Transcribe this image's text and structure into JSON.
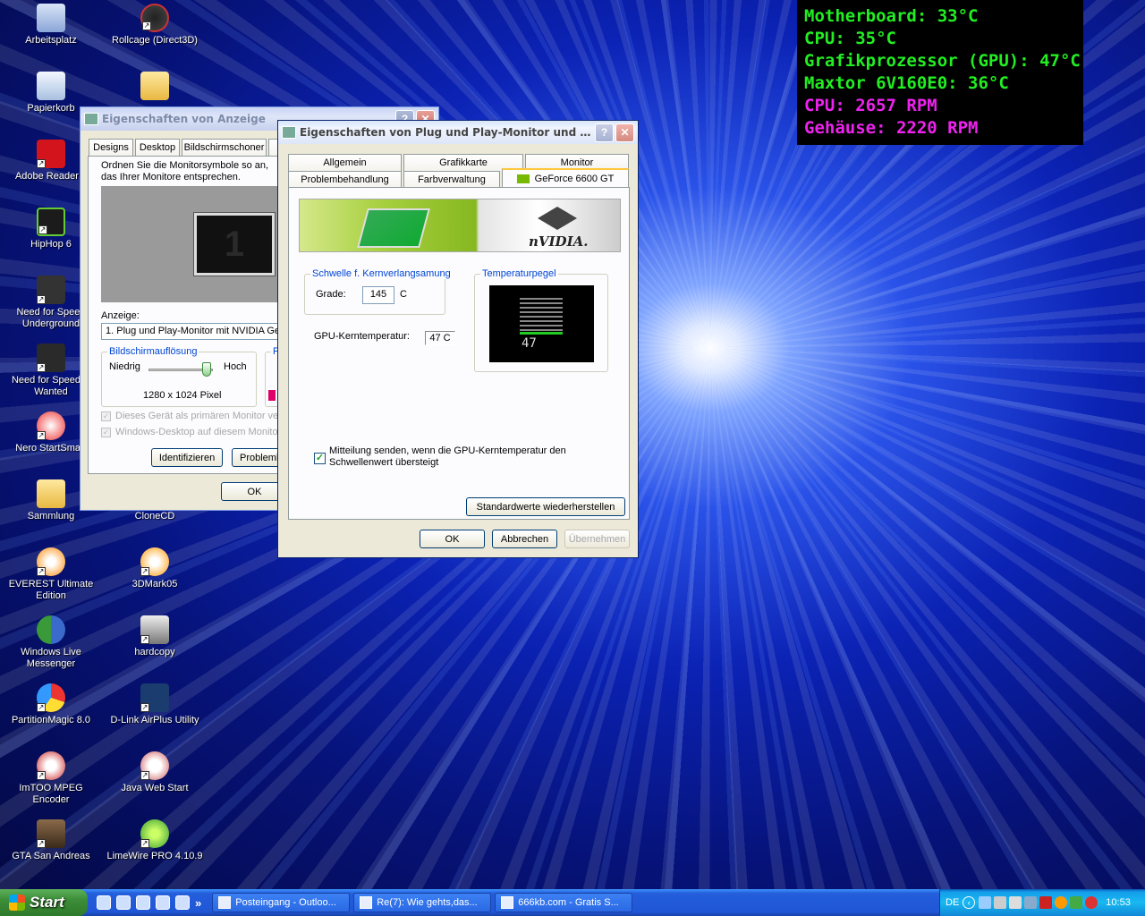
{
  "sensors": [
    {
      "text": "Motherboard: 33°C",
      "color": "#22ee22"
    },
    {
      "text": "CPU: 35°C",
      "color": "#22ee22"
    },
    {
      "text": "Grafikprozessor (GPU): 47°C",
      "color": "#22ee22"
    },
    {
      "text": "Maxtor 6V160E0: 36°C",
      "color": "#22ee22"
    },
    {
      "text": "CPU: 2657 RPM",
      "color": "#ee22ee"
    },
    {
      "text": "Gehäuse: 2220 RPM",
      "color": "#ee22ee"
    }
  ],
  "desktop_icons": [
    "Arbeitsplatz",
    "Rollcage (Direct3D)",
    "Papierkorb",
    "Adobe Reader 7",
    "HipHop 6",
    "Need for Speed Underground",
    "Need for Speed™ Wanted",
    "Nero StartSmart",
    "Sammlung",
    "CloneCD",
    "EVEREST Ultimate Edition",
    "3DMark05",
    "Windows Live Messenger",
    "hardcopy",
    "PartitionMagic 8.0",
    "D-Link AirPlus Utility",
    "ImTOO MPEG Encoder",
    "Java Web Start",
    "GTA San Andreas",
    "LimeWire PRO 4.10.9"
  ],
  "back_dialog": {
    "title": "Eigenschaften von Anzeige",
    "help": "?",
    "close": "✕",
    "tabs": [
      "Designs",
      "Desktop",
      "Bildschirmschoner",
      "D"
    ],
    "instruction": "Ordnen Sie die Monitorsymbole so an, das Ihrer Monitore entsprechen.",
    "monitor_number": "1",
    "display_label": "Anzeige:",
    "display_value": "1. Plug und Play-Monitor mit NVIDIA GeF",
    "resolution_group": "Bildschirmauflösung",
    "low": "Niedrig",
    "high": "Hoch",
    "resolution_value": "1280 x 1024 Pixel",
    "quality_group_cut": "F",
    "check_primary": "Dieses Gerät als primären Monitor verw",
    "check_extend": "Windows-Desktop auf diesem Monitor",
    "identify": "Identifizieren",
    "troubleshoot": "Problemb",
    "ok": "OK"
  },
  "front_dialog": {
    "title": "Eigenschaften von Plug und Play-Monitor und NVI...",
    "help": "?",
    "close": "✕",
    "tabs_row1": [
      "Allgemein",
      "Grafikkarte",
      "Monitor"
    ],
    "tabs_row2": [
      "Problembehandlung",
      "Farbverwaltung",
      "GeForce 6600 GT"
    ],
    "brand": "nVIDIA.",
    "threshold_group": "Schwelle f. Kernverlangsamung",
    "grade_label": "Grade:",
    "grade_value": "145",
    "grade_unit": "C",
    "gpu_temp_label": "GPU-Kerntemperatur:",
    "gpu_temp_value": "47 C",
    "gauge_group": "Temperaturpegel",
    "gauge_value": "47",
    "notify_checked": true,
    "notify_text": "Mitteilung senden, wenn die GPU-Kerntemperatur den Schwellenwert übersteigt",
    "restore": "Standardwerte wiederherstellen",
    "ok": "OK",
    "cancel": "Abbrechen",
    "apply": "Übernehmen"
  },
  "taskbar": {
    "start": "Start",
    "chevron": "»",
    "tasks": [
      "Posteingang - Outloo...",
      "Re(7): Wie gehts,das...",
      "666kb.com - Gratis S..."
    ],
    "lang": "DE",
    "clock": "10:53"
  }
}
